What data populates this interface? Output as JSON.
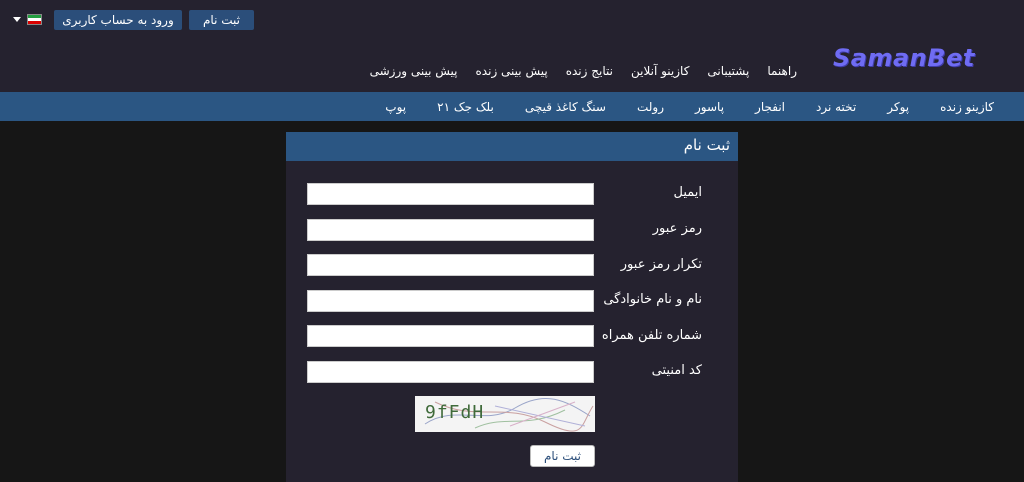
{
  "header": {
    "login_label": "ورود به حساب کاربری",
    "register_label": "ثبت نام",
    "logo_text": "SamanBet",
    "flag_colors": [
      "#239f40",
      "#ffffff",
      "#da0000"
    ],
    "nav": [
      "پیش بینی ورزشی",
      "پیش بینی زنده",
      "نتایج زنده",
      "کازینو آنلاین",
      "پشتیبانی",
      "راهنما"
    ]
  },
  "subnav": [
    "کازینو زنده",
    "پوکر",
    "تخته نرد",
    "انفجار",
    "پاسور",
    "رولت",
    "سنگ کاغذ قیچی",
    "بلک جک ۲۱",
    "پوپ"
  ],
  "form": {
    "title": "ثبت نام",
    "fields": [
      {
        "label": "ایمیل",
        "value": ""
      },
      {
        "label": "رمز عبور",
        "value": ""
      },
      {
        "label": "تکرار رمز عبور",
        "value": ""
      },
      {
        "label": "نام و نام خانوادگی",
        "value": ""
      },
      {
        "label": "شماره تلفن همراه",
        "value": ""
      },
      {
        "label": "کد امنیتی",
        "value": ""
      }
    ],
    "captcha_text": "9fFdH",
    "submit_label": "ثبت نام"
  }
}
